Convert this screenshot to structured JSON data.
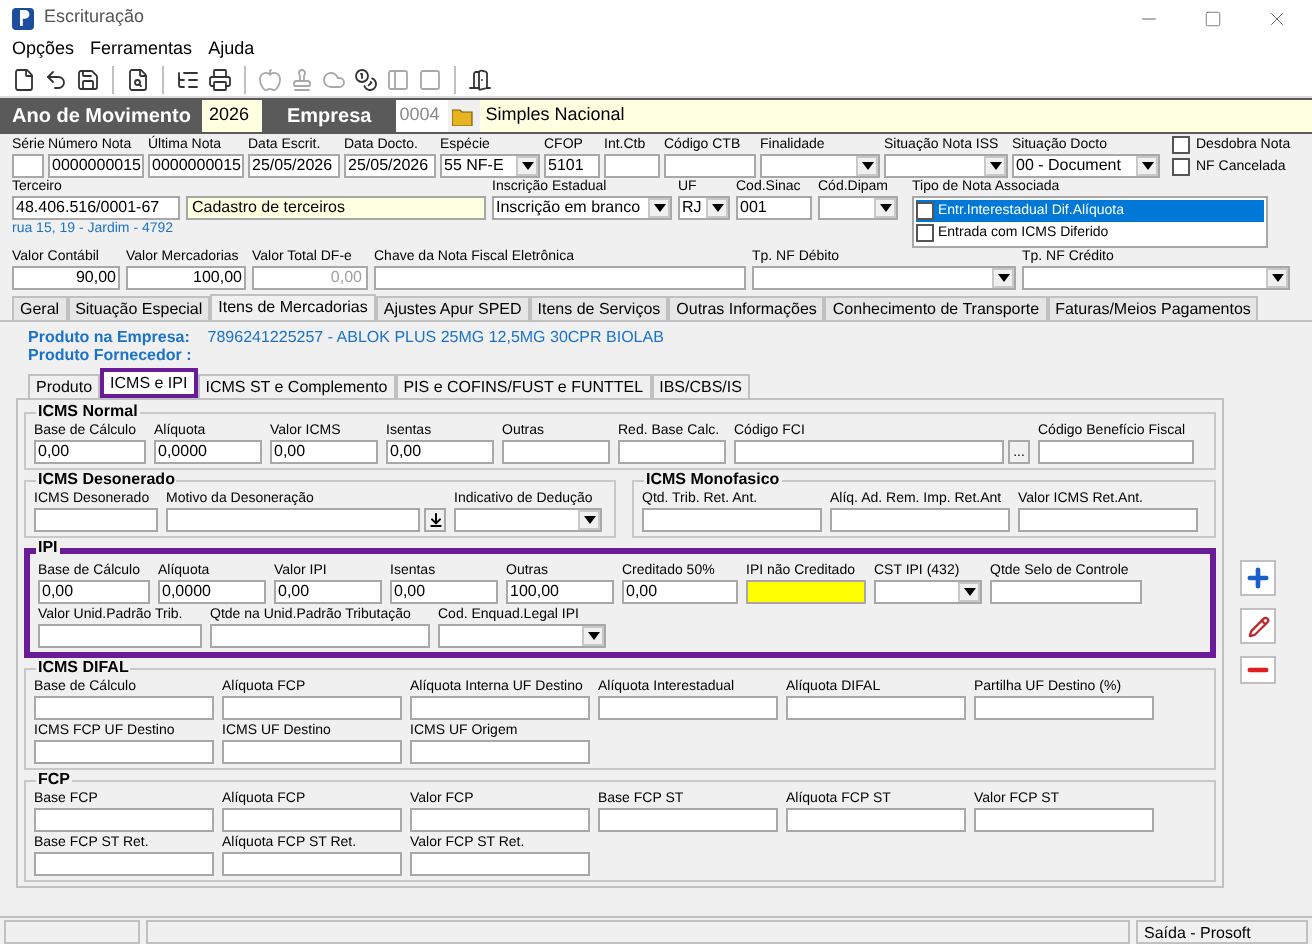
{
  "window": {
    "title": "Escrituração"
  },
  "menu": [
    "Opções",
    "Ferramentas",
    "Ajuda"
  ],
  "toolbar": [
    {
      "kind": "new",
      "disabled": false
    },
    {
      "kind": "undo",
      "disabled": false
    },
    {
      "kind": "save",
      "disabled": false
    },
    {
      "kind": "separator"
    },
    {
      "kind": "preview",
      "disabled": false
    },
    {
      "kind": "separator"
    },
    {
      "kind": "tree",
      "disabled": false
    },
    {
      "kind": "printer",
      "disabled": false
    },
    {
      "kind": "separator"
    },
    {
      "kind": "apple",
      "disabled": true
    },
    {
      "kind": "stamp",
      "disabled": true
    },
    {
      "kind": "cloud",
      "disabled": true
    },
    {
      "kind": "coins",
      "disabled": false
    },
    {
      "kind": "panel",
      "disabled": true
    },
    {
      "kind": "square",
      "disabled": true
    },
    {
      "kind": "separator"
    },
    {
      "kind": "exit",
      "disabled": false
    }
  ],
  "header": {
    "year_label": "Ano de Movimento",
    "year": "2026",
    "company_label": "Empresa",
    "company_code": "0004",
    "company_name": "Simples Nacional"
  },
  "row1": [
    {
      "label": "Série",
      "kind": "text"
    },
    {
      "label": "Número Nota",
      "kind": "text",
      "value": "0000000015"
    },
    {
      "label": "Última Nota",
      "kind": "text",
      "value": "0000000015"
    },
    {
      "label": "Data Escrit.",
      "kind": "text",
      "value": "25/05/2026"
    },
    {
      "label": "Data Docto.",
      "kind": "text",
      "value": "25/05/2026"
    },
    {
      "label": "Espécie",
      "kind": "combo",
      "value": "55  NF-E"
    },
    {
      "label": "CFOP",
      "kind": "text",
      "value": "5101"
    },
    {
      "label": "Int.Ctb",
      "kind": "text"
    },
    {
      "label": "Código CTB",
      "kind": "text"
    },
    {
      "label": "Finalidade",
      "kind": "combo"
    },
    {
      "label": "Situação Nota ISS",
      "kind": "combo"
    },
    {
      "label": "Situação Docto",
      "kind": "combo",
      "value": "00 - Document"
    }
  ],
  "checkboxes": [
    {
      "label": "Desdobra Nota",
      "checked": false
    },
    {
      "label": "NF Cancelada",
      "checked": false
    }
  ],
  "row2": [
    {
      "label": "Terceiro",
      "kind": "text",
      "value": "48.406.516/0001-67"
    },
    {
      "kind": "name",
      "value": "Cadastro de terceiros"
    },
    {
      "label": "Inscrição Estadual",
      "kind": "combo",
      "value": "Inscrição em branco"
    },
    {
      "label": "UF",
      "kind": "combo",
      "value": "RJ"
    },
    {
      "label": "Cod.Sinac",
      "kind": "text",
      "value": "001"
    },
    {
      "label": "Cód.Dipam",
      "kind": "combo"
    }
  ],
  "note_types": {
    "label": "Tipo de Nota Associada",
    "items": [
      {
        "label": "Entr.Interestadual Dif.Alíquota",
        "checked": false,
        "selected": true
      },
      {
        "label": "Entrada com ICMS Diferido",
        "checked": false,
        "selected": false
      }
    ]
  },
  "address": "rua 15, 19 - Jardim - 4792",
  "row3": [
    {
      "label": "Valor Contábil",
      "kind": "text",
      "value": "90,00"
    },
    {
      "label": "Valor Mercadorias",
      "kind": "text",
      "value": "100,00"
    },
    {
      "label": "Valor Total DF-e",
      "kind": "readonly",
      "value": "0,00"
    },
    {
      "label": "Chave da Nota Fiscal Eletrônica",
      "kind": "text"
    },
    {
      "label": "Tp. NF Débito",
      "kind": "combo"
    },
    {
      "label": "Tp. NF Crédito",
      "kind": "combo"
    }
  ],
  "tabs": [
    {
      "label": "Geral",
      "selected": false
    },
    {
      "label": "Situação Especial",
      "selected": false
    },
    {
      "label": "Itens de Mercadorias",
      "selected": true
    },
    {
      "label": "Ajustes Apur SPED",
      "selected": false
    },
    {
      "label": "Itens de Serviços",
      "selected": false
    },
    {
      "label": "Outras Informações",
      "selected": false
    },
    {
      "label": "Conhecimento de Transporte",
      "selected": false
    },
    {
      "label": "Faturas/Meios Pagamentos",
      "selected": false
    }
  ],
  "product": {
    "company_label": "Produto na Empresa:",
    "company_value": "7896241225257 - ABLOK PLUS 25MG 12,5MG 30CPR BIOLAB",
    "supplier_label": "Produto Fornecedor :"
  },
  "subtabs": [
    {
      "label": "Produto",
      "selected": false,
      "highlighted": false
    },
    {
      "label": "ICMS e IPI",
      "selected": true,
      "highlighted": true
    },
    {
      "label": "ICMS ST e Complemento",
      "selected": false,
      "highlighted": false
    },
    {
      "label": "PIS e COFINS/FUST e FUNTTEL",
      "selected": false,
      "highlighted": false
    },
    {
      "label": "IBS/CBS/IS",
      "selected": false,
      "highlighted": false
    }
  ],
  "groups": [
    {
      "title": "ICMS Normal",
      "highlighted": false,
      "rows": [
        [
          {
            "label": "Base de Cálculo",
            "kind": "text",
            "value": "0,00"
          },
          {
            "label": "Alíquota",
            "kind": "text",
            "value": "0,0000"
          },
          {
            "label": "Valor ICMS",
            "kind": "text",
            "value": "0,00"
          },
          {
            "label": "Isentas",
            "kind": "text",
            "value": "0,00"
          },
          {
            "label": "Outras",
            "kind": "text"
          },
          {
            "label": "Red. Base Calc.",
            "kind": "text"
          },
          {
            "label": "Código FCI",
            "kind": "lookup",
            "button_label": "..."
          },
          {
            "label": "Código Benefício Fiscal",
            "kind": "text"
          }
        ]
      ]
    },
    {
      "title": "ICMS Desonerado",
      "highlighted": false,
      "rows": [
        [
          {
            "label": "ICMS Desonerado",
            "kind": "text"
          },
          {
            "label": "Motivo da Desoneração",
            "kind": "download"
          },
          {
            "label": "Indicativo de Dedução",
            "kind": "combo"
          }
        ]
      ]
    },
    {
      "title": "ICMS Monofasico",
      "highlighted": false,
      "rows": [
        [
          {
            "label": "Qtd. Trib. Ret. Ant.",
            "kind": "text"
          },
          {
            "label": "Alíq. Ad. Rem. Imp. Ret.Ant",
            "kind": "text"
          },
          {
            "label": "Valor ICMS Ret.Ant.",
            "kind": "text"
          }
        ]
      ]
    },
    {
      "title": "IPI",
      "highlighted": true,
      "rows": [
        [
          {
            "label": "Base de Cálculo",
            "kind": "text",
            "value": "0,00"
          },
          {
            "label": "Alíquota",
            "kind": "text",
            "value": "0,0000"
          },
          {
            "label": "Valor IPI",
            "kind": "text",
            "value": "0,00"
          },
          {
            "label": "Isentas",
            "kind": "text",
            "value": "0,00"
          },
          {
            "label": "Outras",
            "kind": "text",
            "value": "100,00"
          },
          {
            "label": "Creditado 50%",
            "kind": "text",
            "value": "0,00"
          },
          {
            "label": "IPI não Creditado",
            "kind": "yellow"
          },
          {
            "label": "CST IPI (432)",
            "kind": "combo"
          },
          {
            "label": "Qtde Selo de Controle",
            "kind": "text"
          }
        ]
      ],
      "extra_fields": [
        {
          "label": "Valor Unid.Padrão Trib.",
          "kind": "text"
        },
        {
          "label": "Qtde na Unid.Padrão Tributação",
          "kind": "text"
        },
        {
          "label": "Cod. Enquad.Legal IPI",
          "kind": "combo"
        }
      ]
    },
    {
      "title": "ICMS DIFAL",
      "highlighted": false,
      "rows": [
        [
          {
            "label": "Base de Cálculo",
            "kind": "text"
          },
          {
            "label": "Alíquota FCP",
            "kind": "text"
          },
          {
            "label": "Alíquota Interna UF Destino",
            "kind": "text"
          },
          {
            "label": "Alíquota Interestadual",
            "kind": "text"
          },
          {
            "label": "Alíquota DIFAL",
            "kind": "text"
          },
          {
            "label": "Partilha UF Destino (%)",
            "kind": "text"
          }
        ],
        [
          {
            "label": "ICMS FCP UF Destino",
            "kind": "text"
          },
          {
            "label": "ICMS UF Destino",
            "kind": "text"
          },
          {
            "label": "ICMS UF Origem",
            "kind": "text"
          }
        ]
      ]
    },
    {
      "title": "FCP",
      "highlighted": false,
      "rows": [
        [
          {
            "label": "Base FCP",
            "kind": "text"
          },
          {
            "label": "Alíquota FCP",
            "kind": "text"
          },
          {
            "label": "Valor FCP",
            "kind": "text"
          },
          {
            "label": "Base FCP ST",
            "kind": "text"
          },
          {
            "label": "Alíquota FCP ST",
            "kind": "text"
          },
          {
            "label": "Valor FCP ST",
            "kind": "text"
          }
        ],
        [
          {
            "label": "Base FCP ST Ret.",
            "kind": "text"
          },
          {
            "label": "Alíquota FCP ST Ret.",
            "kind": "text"
          },
          {
            "label": "Valor FCP ST Ret.",
            "kind": "text"
          }
        ]
      ]
    }
  ],
  "side_buttons": [
    {
      "kind": "add"
    },
    {
      "kind": "edit"
    },
    {
      "kind": "remove"
    }
  ],
  "status_bar": {
    "text": "Saída - Prosoft"
  }
}
